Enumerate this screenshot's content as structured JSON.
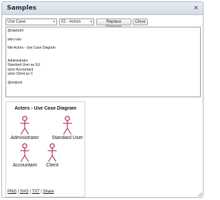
{
  "dialog": {
    "title": "Samples",
    "close_icon": "×"
  },
  "toolbar": {
    "category_select": {
      "value": "Use Case",
      "arrow": "▾"
    },
    "sample_select": {
      "value": "02 - Actors",
      "arrow": "▾"
    },
    "replace_label": "Replace Diagram",
    "close_label": "Close"
  },
  "editor": {
    "lines": [
      "@startuml",
      "",
      "skin rose",
      "",
      "title Actors - Use Case Diagram",
      "",
      "",
      "Administrator",
      "Standard User as SU",
      "actor Accountant",
      "actor Client as C",
      "",
      "@enduml"
    ]
  },
  "preview": {
    "diagram_title": "Actors - Use Case Diagram",
    "actors": [
      "Administrator",
      "Standard User",
      "Accountant",
      "Client"
    ],
    "actor_fill": "#fbe5e8",
    "actor_stroke": "#a8244a",
    "links": [
      "PNG",
      "SVG",
      "TXT",
      "Share"
    ],
    "separator": "|"
  }
}
